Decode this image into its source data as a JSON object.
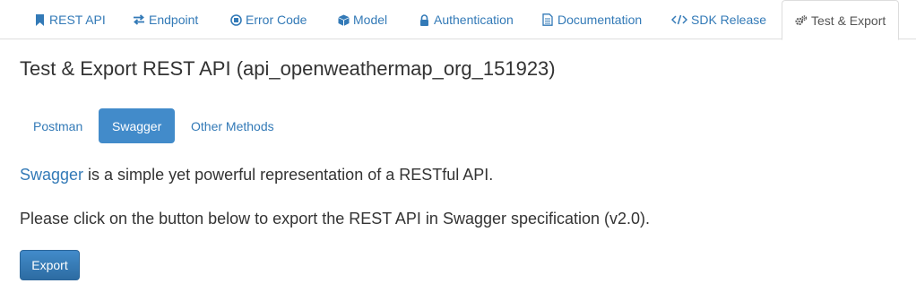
{
  "tabs": [
    {
      "label": "REST API",
      "icon": "bookmark-icon"
    },
    {
      "label": "Endpoint",
      "icon": "exchange-arrows-icon"
    },
    {
      "label": "Error Code",
      "icon": "circle-x-icon"
    },
    {
      "label": "Model",
      "icon": "cube-icon"
    },
    {
      "label": "Authentication",
      "icon": "lock-icon"
    },
    {
      "label": "Documentation",
      "icon": "document-icon"
    },
    {
      "label": "SDK Release",
      "icon": "code-icon"
    },
    {
      "label": "Test & Export",
      "icon": "gears-icon",
      "active": true
    }
  ],
  "page_title": "Test & Export REST API (api_openweathermap_org_151923)",
  "pills": [
    {
      "label": "Postman"
    },
    {
      "label": "Swagger",
      "active": true
    },
    {
      "label": "Other Methods"
    }
  ],
  "content": {
    "swagger_link": "Swagger",
    "swagger_desc": " is a simple yet powerful representation of a RESTful API.",
    "instruction": "Please click on the button below to export the REST API in Swagger specification (v2.0)."
  },
  "export_button": "Export",
  "colors": {
    "link": "#337ab7",
    "active_pill": "#428bca",
    "text": "#333333",
    "border": "#dddddd"
  }
}
